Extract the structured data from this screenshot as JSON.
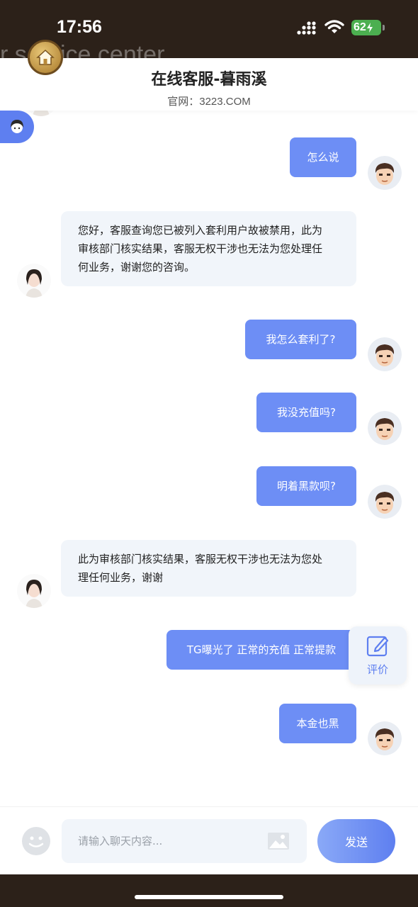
{
  "status_bar": {
    "time": "17:56",
    "battery": "62"
  },
  "background": {
    "watermark": "r service center"
  },
  "header": {
    "title": "在线客服-暮雨溪",
    "subtitle_label": "官网：",
    "subtitle_site": "3223.COM"
  },
  "messages": [
    {
      "from": "user",
      "text": "怎么说"
    },
    {
      "from": "agent",
      "lines": [
        "您好，客服查询您已被列入套利用户故被禁用，此为",
        "审核部门核实结果，客服无权干涉也无法为您处理任",
        "何业务，谢谢您的咨询。"
      ]
    },
    {
      "from": "user",
      "text": "我怎么套利了?"
    },
    {
      "from": "user",
      "text": "我没充值吗?"
    },
    {
      "from": "user",
      "text": "明着黑款呗?"
    },
    {
      "from": "agent",
      "lines": [
        "此为审核部门核实结果，客服无权干涉也无法为您处",
        "理任何业务，谢谢"
      ]
    },
    {
      "from": "user",
      "text": "TG曝光了 正常的充值 正常提款"
    },
    {
      "from": "user",
      "text": "本金也黑"
    }
  ],
  "rate_button": {
    "label": "评价"
  },
  "input_bar": {
    "placeholder": "请输入聊天内容...",
    "send_label": "发送"
  },
  "colors": {
    "accent": "#6d8ef5",
    "frame": "#2c2119",
    "agent_bubble": "#f1f5fa"
  },
  "icons": [
    "home-icon",
    "agent-icon",
    "edit-icon",
    "emoji-icon",
    "image-icon"
  ]
}
